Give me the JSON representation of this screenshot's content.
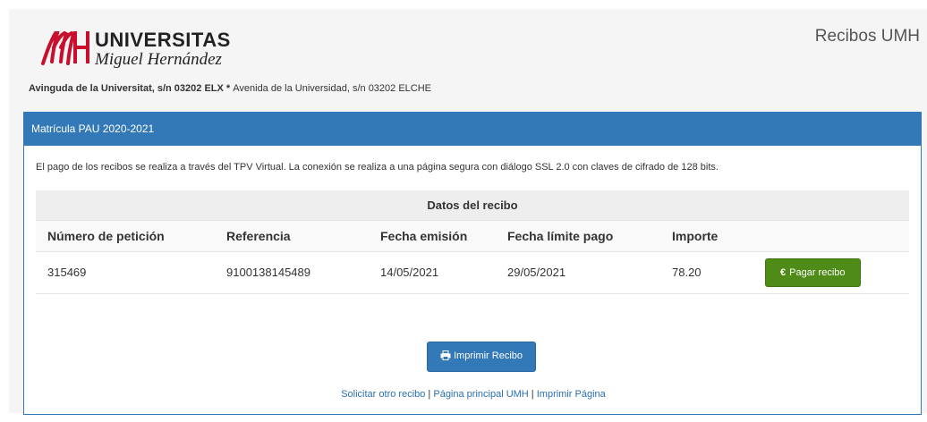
{
  "header": {
    "logo_name": "UNIVERSITAS",
    "logo_sub": "Miguel Hernández",
    "app_title": "Recibos UMH",
    "address_bold": "Avinguda de la Universitat, s/n 03202 ELX",
    "address_sep": " * ",
    "address_rest": "Avenida de la Universidad, s/n 03202 ELCHE"
  },
  "panel": {
    "title": "Matrícula PAU 2020-2021",
    "info": "El pago de los recibos se realiza a través del TPV Virtual. La conexión se realiza a una página segura con diálogo SSL 2.0 con claves de cifrado de 128 bits.",
    "table_caption": "Datos del recibo",
    "columns": [
      "Número de petición",
      "Referencia",
      "Fecha emisión",
      "Fecha límite pago",
      "Importe"
    ],
    "row": {
      "numero": "315469",
      "referencia": "9100138145489",
      "fecha_emision": "14/05/2021",
      "fecha_limite": "29/05/2021",
      "importe": "78.20"
    },
    "pay_button": "Pagar recibo",
    "pay_icon": "€",
    "print_button": "Imprimir Recibo",
    "links": {
      "solicitar": "Solicitar otro recibo",
      "principal": "Página principal UMH",
      "imprimir_pagina": "Imprimir Página",
      "separator": " | "
    }
  },
  "colors": {
    "panel_blue": "#3379b7",
    "pay_green": "#4e8c17",
    "logo_red": "#c8102e",
    "link_blue": "#2a6fb0"
  }
}
